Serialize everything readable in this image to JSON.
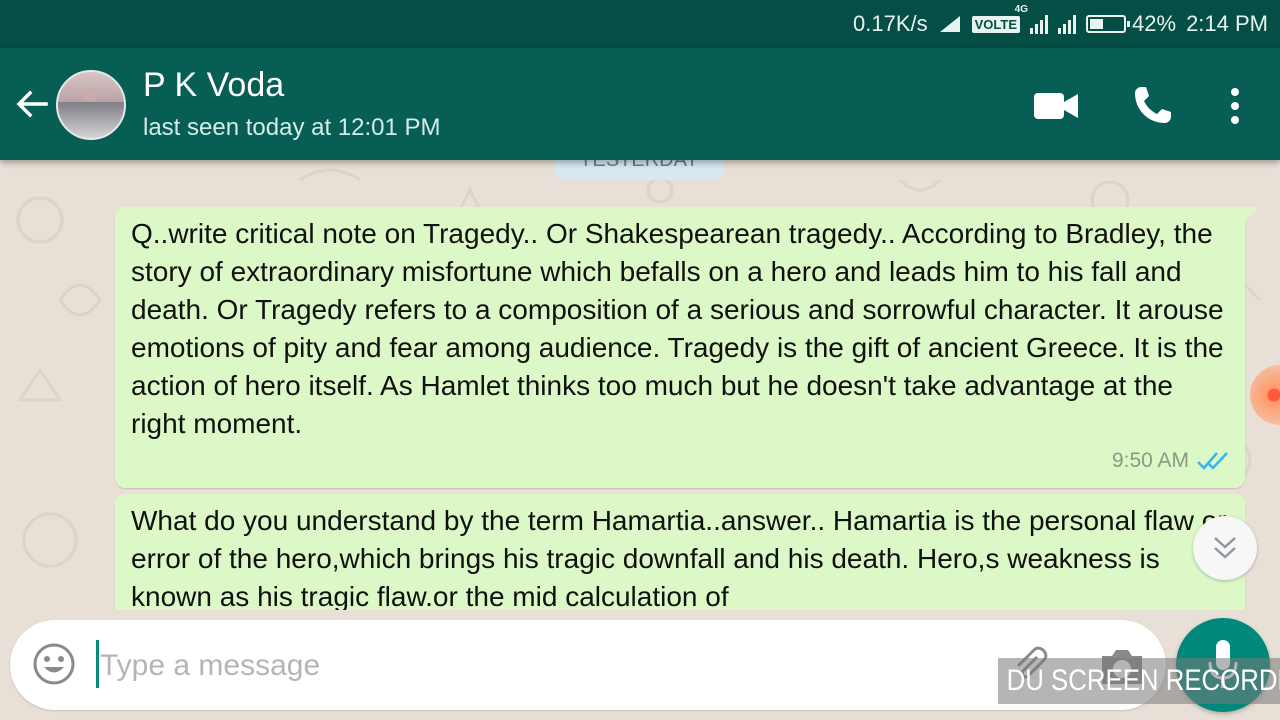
{
  "status_bar": {
    "network_speed": "0.17K/s",
    "volte": "VOLTE",
    "network_type": "4G",
    "battery": "42%",
    "battery_level": 0.42,
    "time": "2:14 PM"
  },
  "header": {
    "contact_name": "P K Voda",
    "last_seen": "last seen today at 12:01 PM",
    "date_chip": "YESTERDAY"
  },
  "messages": [
    {
      "text": "Q..write critical note on Tragedy.. Or Shakespearean tragedy.. According to Bradley, the story of extraordinary misfortune which befalls on a hero and leads  him to his fall and death. Or Tragedy refers to a composition of a serious and sorrowful character. It arouse emotions of pity and fear among audience. Tragedy is the gift of ancient Greece. It is the action of hero itself. As Hamlet thinks too much but he doesn't take advantage at the right moment.",
      "time": "9:50 AM",
      "status": "read"
    },
    {
      "text": "What do you understand by the term Hamartia..answer.. Hamartia is the personal flaw or error of the hero,which brings his tragic downfall and his death. Hero,s weakness is known as his tragic flaw.or the mid calculation of"
    }
  ],
  "input": {
    "placeholder": "Type a message",
    "value": ""
  },
  "watermark": "DU SCREEN RECORDER",
  "colors": {
    "header": "#075e54",
    "status_bar": "#044e45",
    "outgoing_bubble": "#dcf8c6",
    "fab": "#00897b",
    "read_ticks": "#34b7f1"
  }
}
